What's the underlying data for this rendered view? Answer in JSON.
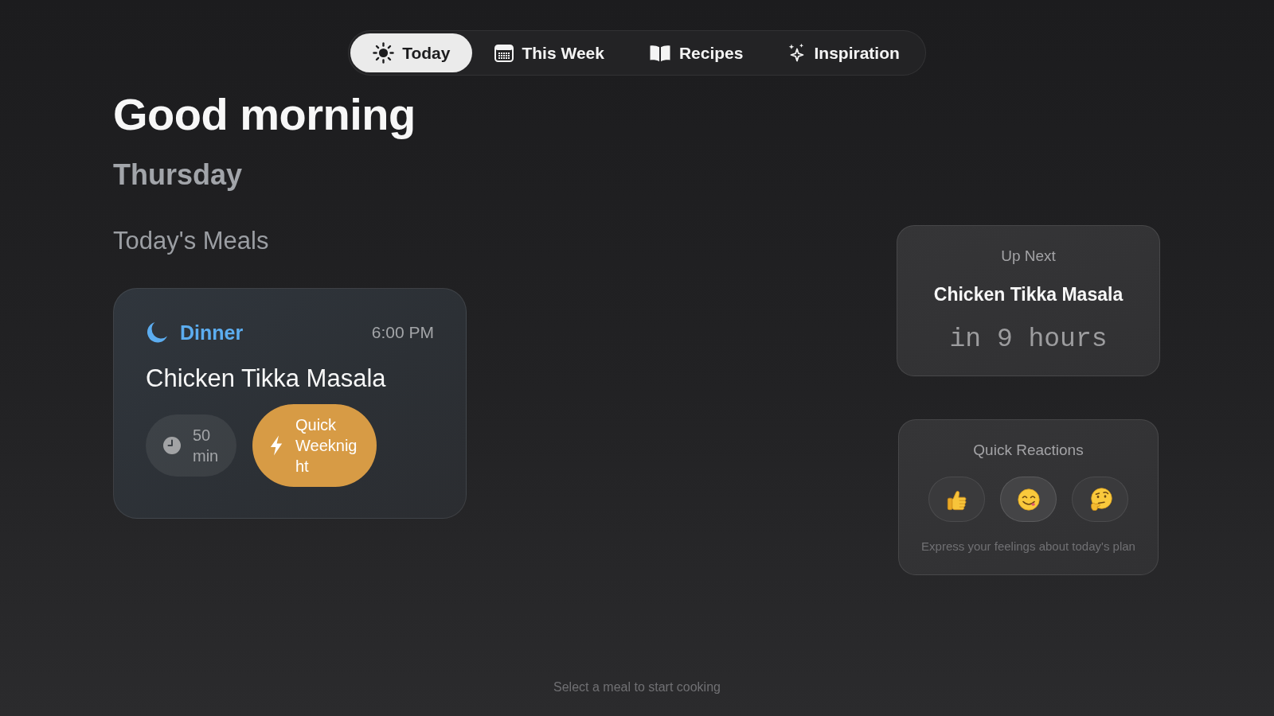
{
  "nav": {
    "tabs": [
      {
        "kind": "sun",
        "label": "Today",
        "selected": true
      },
      {
        "kind": "calendar",
        "label": "This Week",
        "selected": false
      },
      {
        "kind": "book",
        "label": "Recipes",
        "selected": false
      },
      {
        "kind": "sparkles",
        "label": "Inspiration",
        "selected": false
      }
    ]
  },
  "greeting": {
    "title": "Good morning",
    "day": "Thursday"
  },
  "meals_section": {
    "title": "Today's Meals",
    "meals": [
      {
        "kind": "dinner",
        "label": "Dinner",
        "time": "6:00 PM",
        "name": "Chicken Tikka Masala",
        "tags": [
          {
            "kind": "duration",
            "label": "50 min"
          },
          {
            "kind": "quick",
            "label": "Quick Weeknight"
          }
        ]
      }
    ]
  },
  "up_next": {
    "title": "Up Next",
    "meal": "Chicken Tikka Masala",
    "countdown": "in 9 hours"
  },
  "quick_reactions": {
    "title": "Quick Reactions",
    "reactions": [
      {
        "kind": "thumbs_up",
        "selected": false
      },
      {
        "kind": "yum",
        "selected": true
      },
      {
        "kind": "thinking",
        "selected": false
      }
    ],
    "caption": "Express your feelings about today's plan"
  },
  "footer": {
    "hint": "Select a meal to start cooking"
  }
}
